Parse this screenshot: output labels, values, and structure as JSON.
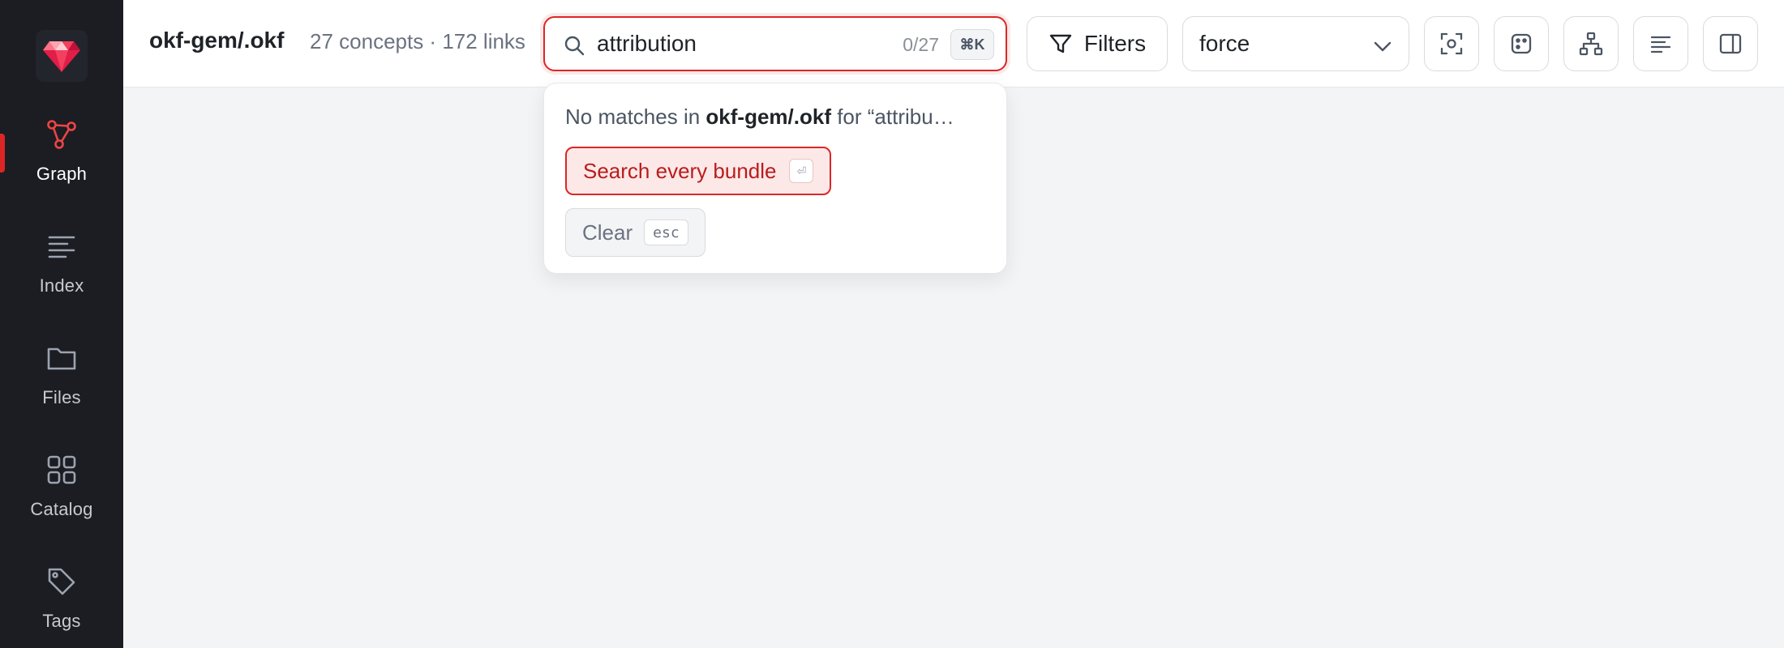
{
  "sidebar": {
    "logo_icon": "gem-icon",
    "accent": "#dc2626",
    "items": [
      {
        "label": "Graph",
        "icon": "graph-icon",
        "active": true
      },
      {
        "label": "Index",
        "icon": "lines-icon",
        "active": false
      },
      {
        "label": "Files",
        "icon": "folder-icon",
        "active": false
      },
      {
        "label": "Catalog",
        "icon": "grid-icon",
        "active": false
      },
      {
        "label": "Tags",
        "icon": "tag-icon",
        "active": false
      }
    ]
  },
  "header": {
    "bundle_name": "okf-gem/.okf",
    "stats": "27 concepts · 172 links",
    "search": {
      "value": "attribution",
      "count": "0/27",
      "shortcut": "⌘K"
    },
    "filters_label": "Filters",
    "layout_value": "force",
    "toolbar_icons": [
      "focus-icon",
      "random-icon",
      "hierarchy-icon",
      "align-left-icon",
      "panel-right-icon"
    ]
  },
  "dropdown": {
    "message_prefix": "No matches in ",
    "message_bundle": "okf-gem/.okf",
    "message_suffix": " for “attribu…",
    "primary_label": "Search every bundle",
    "primary_kbd": "⏎",
    "secondary_label": "Clear",
    "secondary_kbd": "esc"
  }
}
